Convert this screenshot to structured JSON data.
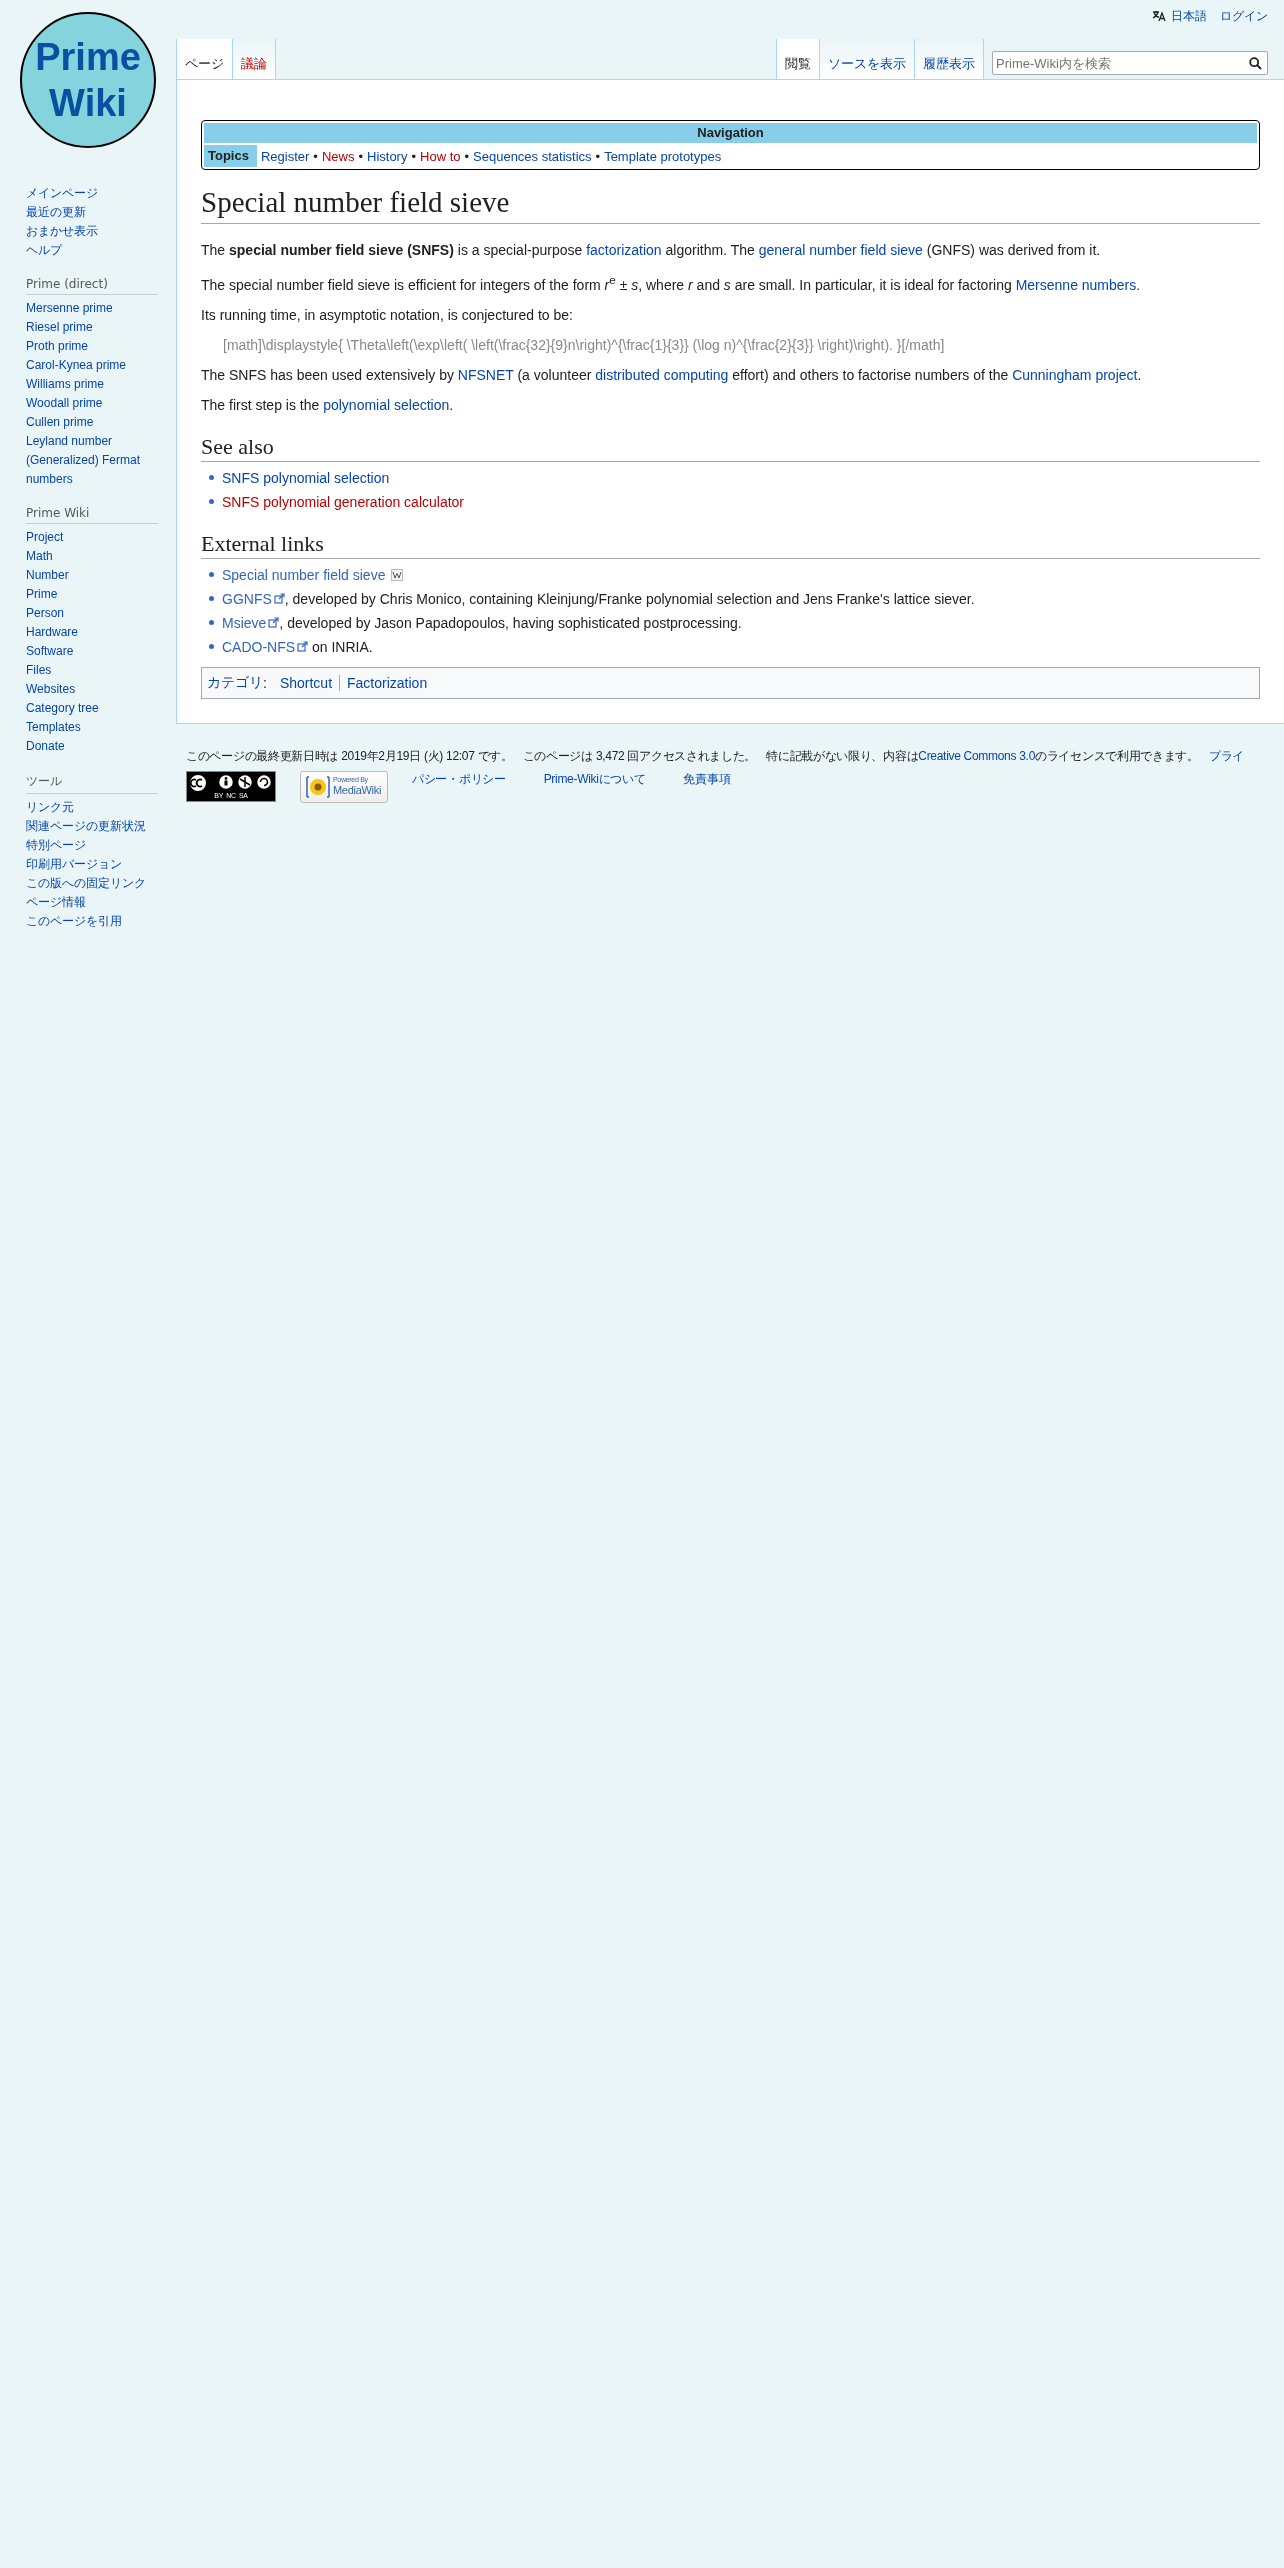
{
  "personal_tools": [
    {
      "text": "日本語",
      "kind": "language"
    },
    {
      "text": "ログイン",
      "kind": "link"
    }
  ],
  "logo": {
    "lines": [
      "Prime",
      "Wiki"
    ]
  },
  "sidebar": {
    "main": [
      "メインページ",
      "最近の更新",
      "おまかせ表示",
      "ヘルプ"
    ],
    "sections": [
      {
        "heading": "Prime (direct)",
        "items": [
          "Mersenne prime",
          "Riesel prime",
          "Proth prime",
          "Carol-Kynea prime",
          "Williams prime",
          "Woodall prime",
          "Cullen prime",
          "Leyland number",
          "(Generalized) Fermat numbers"
        ]
      },
      {
        "heading": "Prime Wiki",
        "items": [
          "Project",
          "Math",
          "Number",
          "Prime",
          "Person",
          "Hardware",
          "Software",
          "Files",
          "Websites",
          "Category tree",
          "Templates",
          "Donate"
        ]
      },
      {
        "heading": "ツール",
        "items": [
          "リンク元",
          "関連ページの更新状況",
          "特別ページ",
          "印刷用バージョン",
          "この版への固定リンク",
          "ページ情報",
          "このページを引用"
        ]
      }
    ]
  },
  "tabs_left": [
    {
      "label": "ページ",
      "selected": true,
      "missing": false
    },
    {
      "label": "議論",
      "selected": false,
      "missing": true
    }
  ],
  "tabs_right": [
    {
      "label": "閲覧",
      "selected": true
    },
    {
      "label": "ソースを表示",
      "selected": false
    },
    {
      "label": "履歴表示",
      "selected": false
    }
  ],
  "search": {
    "placeholder": "Prime-Wiki内を検索"
  },
  "navbox": {
    "title": "Navigation",
    "group": "Topics",
    "items": [
      {
        "text": "Register",
        "missing": false
      },
      {
        "text": "News",
        "missing": true
      },
      {
        "text": "History",
        "missing": false
      },
      {
        "text": "How to",
        "missing": true
      },
      {
        "text": "Sequences statistics",
        "missing": false
      },
      {
        "text": "Template prototypes",
        "missing": false
      }
    ],
    "separator": "•"
  },
  "title": "Special number field sieve",
  "paragraphs": [
    {
      "kind": "text",
      "parts": [
        {
          "kind": "text",
          "text": "The **special number field sieve (SNFS)** is a special-purpose "
        },
        {
          "kind": "link",
          "text": "factorization"
        },
        {
          "kind": "text",
          "text": " algorithm. The "
        },
        {
          "kind": "link",
          "text": "general number field sieve"
        },
        {
          "kind": "text",
          "text": " (GNFS) was derived from it."
        }
      ]
    },
    {
      "kind": "text",
      "parts": [
        {
          "kind": "text",
          "text": "The special number field sieve is efficient for integers of the form *r*$^{e}$ ± *s*, where *r* and *s* are small. In particular, it is ideal for factoring "
        },
        {
          "kind": "link",
          "text": "Mersenne numbers"
        },
        {
          "kind": "text",
          "text": "."
        }
      ]
    },
    {
      "kind": "text",
      "parts": [
        {
          "kind": "text",
          "text": "Its running time, in asymptotic notation, is conjectured to be:"
        }
      ]
    },
    {
      "kind": "math",
      "parts": [
        {
          "kind": "text",
          "text": "[math]\\displaystyle{ \\Theta\\left(\\exp\\left( \\left(\\frac{32}{9}n\\right)^{\\frac{1}{3}} (\\log n)^{\\frac{2}{3}} \\right)\\right). }[/math]"
        }
      ]
    },
    {
      "kind": "text",
      "parts": [
        {
          "kind": "text",
          "text": "The SNFS has been used extensively by "
        },
        {
          "kind": "link",
          "text": "NFSNET"
        },
        {
          "kind": "text",
          "text": " (a volunteer "
        },
        {
          "kind": "link",
          "text": "distributed computing"
        },
        {
          "kind": "text",
          "text": " effort) and others to factorise numbers of the "
        },
        {
          "kind": "link",
          "text": "Cunningham project"
        },
        {
          "kind": "text",
          "text": "."
        }
      ]
    },
    {
      "kind": "text",
      "parts": [
        {
          "kind": "text",
          "text": "The first step is the "
        },
        {
          "kind": "link",
          "text": "polynomial selection"
        },
        {
          "kind": "text",
          "text": "."
        }
      ]
    }
  ],
  "sections": [
    {
      "heading": "See also",
      "items": [
        {
          "parts": [
            {
              "kind": "link",
              "text": "SNFS polynomial selection",
              "missing": false
            }
          ]
        },
        {
          "parts": [
            {
              "kind": "link",
              "text": "SNFS polynomial generation calculator",
              "missing": true
            }
          ]
        }
      ]
    },
    {
      "heading": "External links",
      "items": [
        {
          "parts": [
            {
              "kind": "wiki",
              "text": "Special number field sieve"
            }
          ]
        },
        {
          "parts": [
            {
              "kind": "external",
              "text": "GGNFS"
            },
            {
              "kind": "text",
              "text": ", developed by Chris Monico, containing Kleinjung/Franke polynomial selection and Jens Franke's lattice siever."
            }
          ]
        },
        {
          "parts": [
            {
              "kind": "external",
              "text": "Msieve"
            },
            {
              "kind": "text",
              "text": ", developed by Jason Papadopoulos, having sophisticated postprocessing."
            }
          ]
        },
        {
          "parts": [
            {
              "kind": "external",
              "text": "CADO-NFS"
            },
            {
              "kind": "text",
              "text": " on INRIA."
            }
          ]
        }
      ]
    }
  ],
  "categories": {
    "label": "カテゴリ",
    "colon": ":",
    "items": [
      "Shortcut",
      "Factorization"
    ]
  },
  "footer": {
    "info": [
      {
        "parts": [
          {
            "kind": "text",
            "text": "このページの最終更新日時は 2019年2月19日 (火) 12:07 です。"
          }
        ]
      },
      {
        "parts": [
          {
            "kind": "text",
            "text": "このページは 3,472 回アクセスされました。"
          }
        ]
      },
      {
        "parts": [
          {
            "kind": "text",
            "text": "特に記載がない限り、内容は"
          },
          {
            "kind": "link",
            "text": "Creative Commons 3.0"
          },
          {
            "kind": "text",
            "text": "のライセンスで利用できます。"
          }
        ]
      },
      {
        "parts": [
          {
            "kind": "link",
            "text": "プライ"
          }
        ]
      }
    ],
    "badges": [
      {
        "kind": "cc",
        "text": "BY  NC  SA"
      },
      {
        "kind": "mediawiki",
        "lines": [
          "Powered By",
          "MediaWiki"
        ]
      }
    ],
    "places": [
      "パシー・ポリシー",
      "Prime-Wikiについて",
      "免責事項"
    ]
  }
}
